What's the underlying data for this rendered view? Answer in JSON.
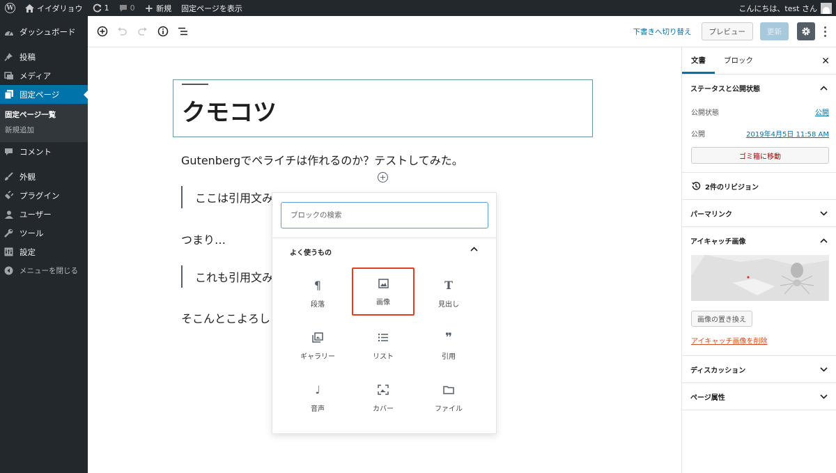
{
  "adminbar": {
    "site_name": "イイダリョウ",
    "updates_count": "1",
    "comments_count": "0",
    "new_label": "新規",
    "view_page_label": "固定ページを表示",
    "greeting": "こんにちは、test さん"
  },
  "sidebar": {
    "items": [
      {
        "label": "ダッシュボード",
        "icon": "dashboard-icon"
      },
      {
        "label": "投稿",
        "icon": "pin-icon"
      },
      {
        "label": "メディア",
        "icon": "media-icon"
      },
      {
        "label": "固定ページ",
        "icon": "page-icon"
      },
      {
        "label": "コメント",
        "icon": "comment-icon"
      },
      {
        "label": "外観",
        "icon": "brush-icon"
      },
      {
        "label": "プラグイン",
        "icon": "plugin-icon"
      },
      {
        "label": "ユーザー",
        "icon": "user-icon"
      },
      {
        "label": "ツール",
        "icon": "wrench-icon"
      },
      {
        "label": "設定",
        "icon": "settings-icon"
      },
      {
        "label": "メニューを閉じる",
        "icon": "collapse-icon"
      }
    ],
    "submenu": [
      "固定ページ一覧",
      "新規追加"
    ]
  },
  "toolbar": {
    "switch_draft": "下書きへ切り替え",
    "preview": "プレビュー",
    "update": "更新"
  },
  "editor": {
    "title": "クモコツ",
    "paragraph1": "Gutenbergでペライチは作れるのか？テストしてみた。",
    "quote1": "ここは引用文み",
    "paragraph2": "つまり…",
    "quote2": "これも引用文み",
    "paragraph3": "そこんとこよろし"
  },
  "inserter": {
    "search_placeholder": "ブロックの検索",
    "panel_title": "よく使うもの",
    "blocks": [
      {
        "label": "段落",
        "icon": "paragraph-icon"
      },
      {
        "label": "画像",
        "icon": "image-icon"
      },
      {
        "label": "見出し",
        "icon": "heading-icon"
      },
      {
        "label": "ギャラリー",
        "icon": "gallery-icon"
      },
      {
        "label": "リスト",
        "icon": "list-icon"
      },
      {
        "label": "引用",
        "icon": "quote-icon"
      },
      {
        "label": "音声",
        "icon": "audio-icon"
      },
      {
        "label": "カバー",
        "icon": "cover-icon"
      },
      {
        "label": "ファイル",
        "icon": "file-icon"
      }
    ],
    "highlight_color": "#e2401c"
  },
  "panel": {
    "tab_document": "文書",
    "tab_block": "ブロック",
    "status_title": "ステータスと公開状態",
    "visibility_label": "公開状態",
    "visibility_value": "公開",
    "publish_label": "公開",
    "publish_value": "2019年4月5日 11:58 AM",
    "trash_button": "ゴミ箱に移動",
    "revisions": "2件のリビジョン",
    "permalink": "パーマリンク",
    "featured_image": "アイキャッチ画像",
    "replace_image": "画像の置き換え",
    "remove_image": "アイキャッチ画像を削除",
    "discussion": "ディスカッション",
    "page_attributes": "ページ属性"
  },
  "colors": {
    "admin_dark": "#23282d",
    "accent": "#0073aa",
    "danger": "#a00"
  }
}
